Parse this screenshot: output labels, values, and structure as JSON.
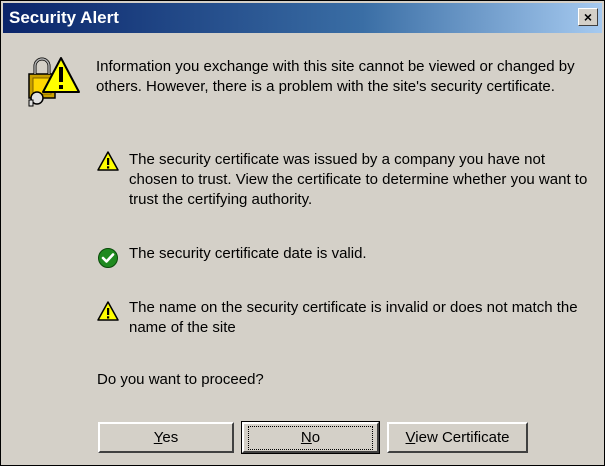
{
  "window": {
    "title": "Security Alert",
    "close_glyph": "×"
  },
  "intro_text": "Information you exchange with this site cannot be viewed or changed by others. However, there is a problem with the site's security certificate.",
  "items": [
    {
      "icon": "warning-icon",
      "text": "The security certificate was issued by a company you have not chosen to trust. View the certificate to determine whether you want to trust the certifying authority."
    },
    {
      "icon": "check-icon",
      "text": "The security certificate date is valid."
    },
    {
      "icon": "warning-icon",
      "text": "The name on the security certificate is invalid or does not match the name of the site"
    }
  ],
  "question": "Do you want to proceed?",
  "buttons": {
    "yes": {
      "mnemonic": "Y",
      "rest": "es"
    },
    "no": {
      "mnemonic": "N",
      "rest": "o"
    },
    "view": {
      "mnemonic": "V",
      "rest": "iew Certificate"
    }
  },
  "colors": {
    "face": "#d4d0c8",
    "title_start": "#0a246a",
    "title_end": "#a6caf0",
    "warning": "#ffff00",
    "check": "#1f8a1f"
  }
}
